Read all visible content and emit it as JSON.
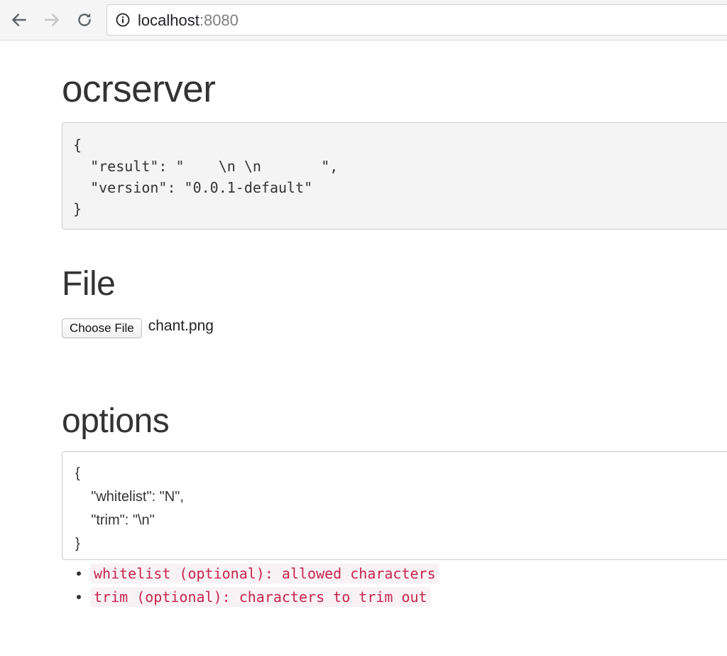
{
  "browser": {
    "url_host": "localhost",
    "url_port": ":8080",
    "icons": [
      "back-arrow-icon",
      "forward-arrow-icon",
      "reload-icon",
      "info-icon"
    ]
  },
  "page": {
    "title": "ocrserver",
    "result_json": "{\n  \"result\": \"    \\n \\n       \",\n  \"version\": \"0.0.1-default\"\n}",
    "file_heading": "File",
    "choose_file_label": "Choose File",
    "file_name": "chant.png",
    "options_heading": "options",
    "options_json": "{\n\t\"whitelist\": \"N\",\n\t\"trim\": \"\\n\"\n}",
    "help_items": [
      "whitelist (optional): allowed characters",
      "trim (optional): characters to trim out"
    ]
  },
  "colors": {
    "code_text": "#c7254e",
    "code_bg": "#f9f2f4",
    "pre_bg": "#f4f4f4"
  }
}
